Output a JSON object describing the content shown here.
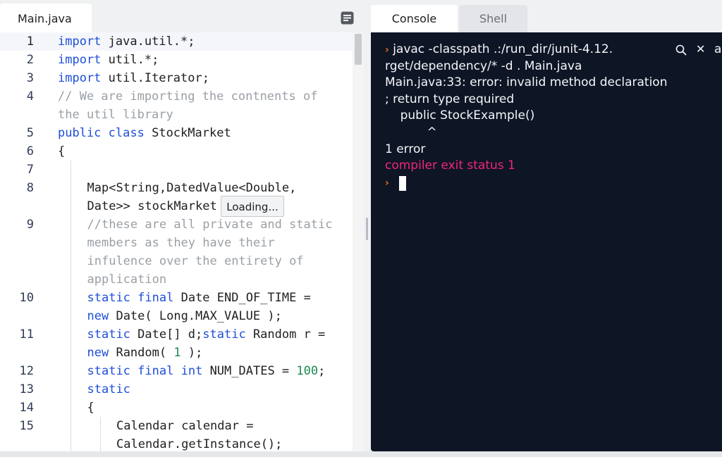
{
  "editor": {
    "file_tab": "Main.java",
    "menu_icon": "document-lines-icon",
    "loading_tooltip": "Loading...",
    "lines": [
      {
        "num": "1",
        "parts": [
          {
            "t": "import",
            "c": "kw"
          },
          {
            "t": " java.util.*;",
            "c": ""
          }
        ]
      },
      {
        "num": "2",
        "parts": [
          {
            "t": "import",
            "c": "kw"
          },
          {
            "t": " util.*;",
            "c": ""
          }
        ]
      },
      {
        "num": "3",
        "parts": [
          {
            "t": "import",
            "c": "kw"
          },
          {
            "t": " util.Iterator;",
            "c": ""
          }
        ]
      },
      {
        "num": "4",
        "parts": [
          {
            "t": "// We are importing the contnents of",
            "c": "cm"
          }
        ]
      },
      {
        "num": "",
        "parts": [
          {
            "t": "the util library",
            "c": "cm"
          }
        ]
      },
      {
        "num": "5",
        "parts": [
          {
            "t": "public",
            "c": "kw"
          },
          {
            "t": " ",
            "c": ""
          },
          {
            "t": "class",
            "c": "kw"
          },
          {
            "t": " StockMarket",
            "c": ""
          }
        ]
      },
      {
        "num": "6",
        "parts": [
          {
            "t": "{",
            "c": ""
          }
        ]
      },
      {
        "num": "7",
        "parts": []
      },
      {
        "num": "8",
        "parts": [
          {
            "t": "Map<String,DatedValue<Double,",
            "c": ""
          }
        ]
      },
      {
        "num": "",
        "parts": [
          {
            "t": "Date>> stockMarket",
            "c": ""
          }
        ]
      },
      {
        "num": "9",
        "parts": [
          {
            "t": "//these are all private and static",
            "c": "cm"
          }
        ]
      },
      {
        "num": "",
        "parts": [
          {
            "t": "members as they have their",
            "c": "cm"
          }
        ]
      },
      {
        "num": "",
        "parts": [
          {
            "t": "infulence over the entirety of",
            "c": "cm"
          }
        ]
      },
      {
        "num": "",
        "parts": [
          {
            "t": "application",
            "c": "cm"
          }
        ]
      },
      {
        "num": "10",
        "parts": [
          {
            "t": "static",
            "c": "kw"
          },
          {
            "t": " ",
            "c": ""
          },
          {
            "t": "final",
            "c": "kw"
          },
          {
            "t": " Date END_OF_TIME =",
            "c": ""
          }
        ]
      },
      {
        "num": "",
        "parts": [
          {
            "t": "new",
            "c": "kw"
          },
          {
            "t": " Date( Long.MAX_VALUE );",
            "c": ""
          }
        ]
      },
      {
        "num": "11",
        "parts": [
          {
            "t": "static",
            "c": "kw"
          },
          {
            "t": " Date[] d;",
            "c": ""
          },
          {
            "t": "static",
            "c": "kw"
          },
          {
            "t": " Random r =",
            "c": ""
          }
        ]
      },
      {
        "num": "",
        "parts": [
          {
            "t": "new",
            "c": "kw"
          },
          {
            "t": " Random( ",
            "c": ""
          },
          {
            "t": "1",
            "c": "num"
          },
          {
            "t": " );",
            "c": ""
          }
        ]
      },
      {
        "num": "12",
        "parts": [
          {
            "t": "static",
            "c": "kw"
          },
          {
            "t": " ",
            "c": ""
          },
          {
            "t": "final",
            "c": "kw"
          },
          {
            "t": " ",
            "c": ""
          },
          {
            "t": "int",
            "c": "kw"
          },
          {
            "t": " NUM_DATES = ",
            "c": ""
          },
          {
            "t": "100",
            "c": "num"
          },
          {
            "t": ";",
            "c": ""
          }
        ]
      },
      {
        "num": "13",
        "parts": [
          {
            "t": "static",
            "c": "kw"
          }
        ]
      },
      {
        "num": "14",
        "parts": [
          {
            "t": "{",
            "c": ""
          }
        ]
      },
      {
        "num": "15",
        "parts": [
          {
            "t": "Calendar calendar =",
            "c": ""
          }
        ]
      },
      {
        "num": "",
        "parts": [
          {
            "t": "Calendar.getInstance();",
            "c": ""
          }
        ]
      }
    ]
  },
  "console": {
    "tabs": [
      "Console",
      "Shell"
    ],
    "search_icon": "search-icon",
    "close_icon": "close-icon",
    "lines": [
      {
        "prompt": true,
        "text": "javac -classpath .:/run_dir/junit-4.12.",
        "err": false
      },
      {
        "prompt": false,
        "text": "rget/dependency/* -d . Main.java",
        "err": false
      },
      {
        "prompt": false,
        "text": "Main.java:33: error: invalid method declaration",
        "err": false
      },
      {
        "prompt": false,
        "text": "; return type required",
        "err": false
      },
      {
        "prompt": false,
        "text": "    public StockExample()",
        "err": false
      },
      {
        "prompt": false,
        "text": "           ^",
        "err": false
      },
      {
        "prompt": false,
        "text": "1 error",
        "err": false
      },
      {
        "prompt": false,
        "text": "compiler exit status 1",
        "err": true
      },
      {
        "prompt": true,
        "text": "",
        "err": false
      }
    ],
    "trailing_char": "a"
  },
  "colors": {
    "keyword": "#1e4fd8",
    "comment": "#9aa0a6",
    "number": "#1d8a52",
    "console_bg": "#0e1525",
    "error": "#f0267a",
    "prompt": "#f26b1d"
  }
}
